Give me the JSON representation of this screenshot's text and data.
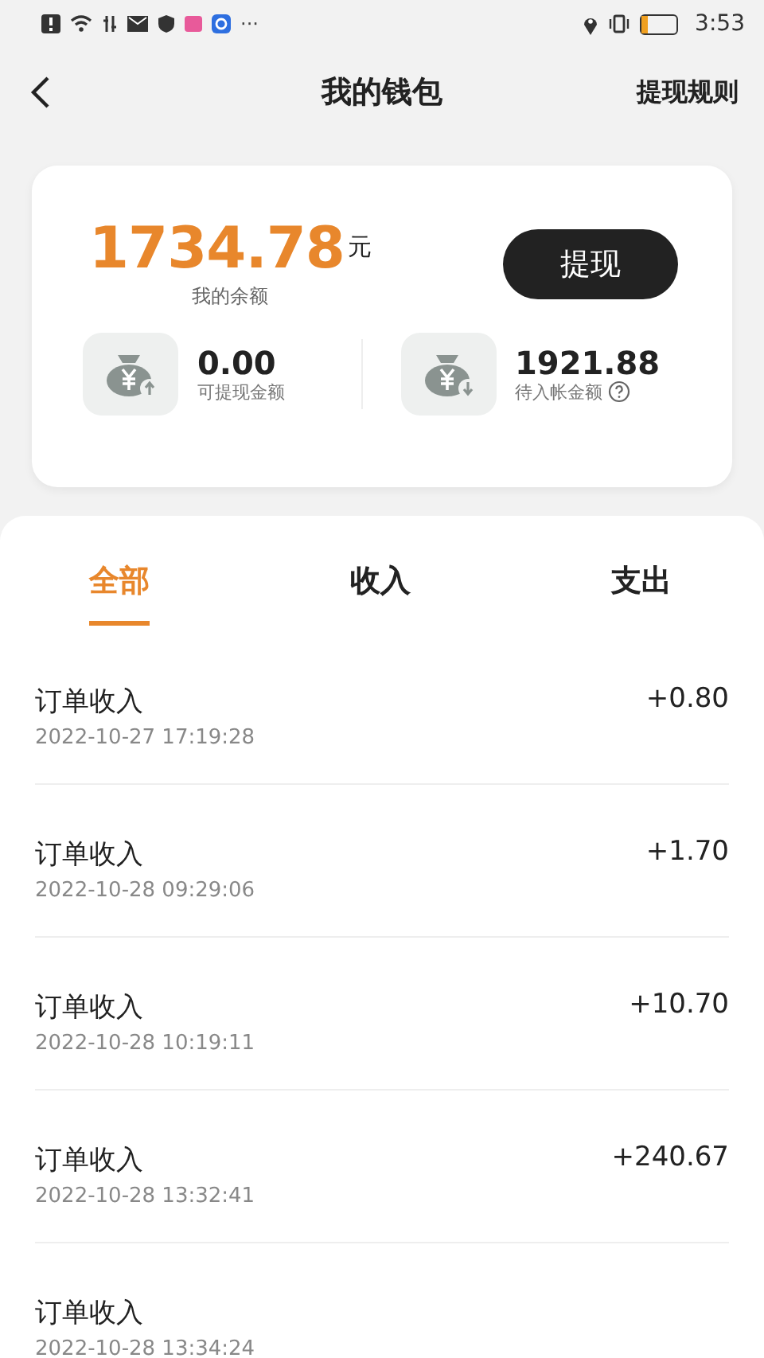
{
  "status_bar": {
    "more": "···",
    "time": "3:53"
  },
  "header": {
    "title": "我的钱包",
    "action": "提现规则"
  },
  "balance": {
    "amount": "1734.78",
    "unit": "元",
    "label": "我的余额",
    "button": "提现"
  },
  "stats": [
    {
      "kind": "up",
      "value": "0.00",
      "label": "可提现金额",
      "help": false
    },
    {
      "kind": "down",
      "value": "1921.88",
      "label": "待入帐金额",
      "help": true
    }
  ],
  "tabs": [
    {
      "label": "全部",
      "selected": true
    },
    {
      "label": "收入",
      "selected": false
    },
    {
      "label": "支出",
      "selected": false
    }
  ],
  "transactions": [
    {
      "title": "订单收入",
      "time": "2022-10-27 17:19:28",
      "amount": "+0.80"
    },
    {
      "title": "订单收入",
      "time": "2022-10-28 09:29:06",
      "amount": "+1.70"
    },
    {
      "title": "订单收入",
      "time": "2022-10-28 10:19:11",
      "amount": "+10.70"
    },
    {
      "title": "订单收入",
      "time": "2022-10-28 13:32:41",
      "amount": "+240.67"
    },
    {
      "title": "订单收入",
      "time": "2022-10-28 13:34:24"
    }
  ]
}
